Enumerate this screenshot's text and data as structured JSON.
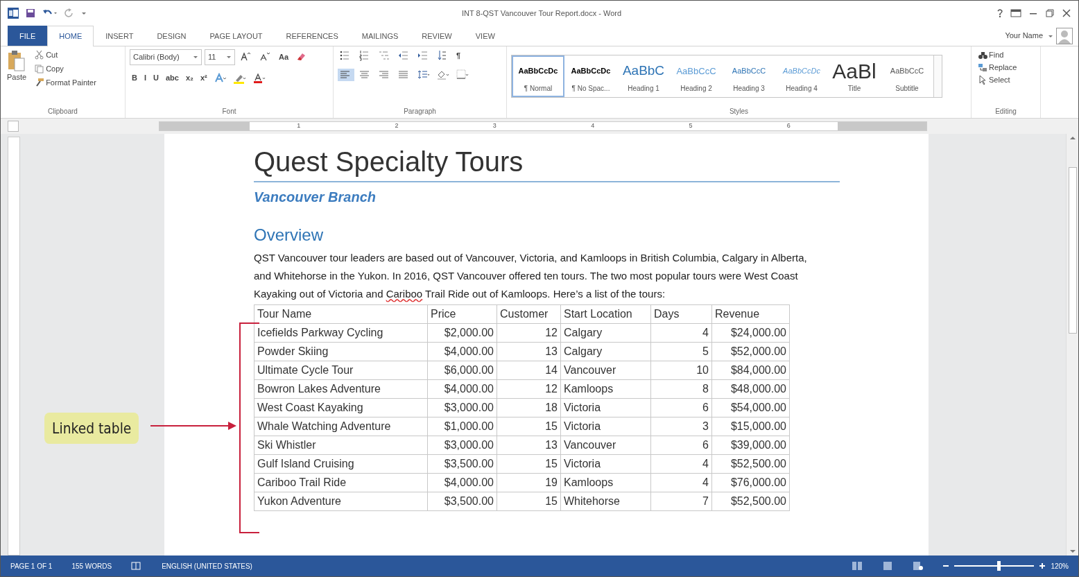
{
  "window": {
    "title": "INT 8-QST Vancouver Tour Report.docx - Word"
  },
  "tabs": [
    {
      "label": "FILE",
      "kind": "file",
      "selected": false
    },
    {
      "label": "HOME",
      "kind": "tab",
      "selected": true
    },
    {
      "label": "INSERT",
      "kind": "tab",
      "selected": false
    },
    {
      "label": "DESIGN",
      "kind": "tab",
      "selected": false
    },
    {
      "label": "PAGE LAYOUT",
      "kind": "tab",
      "selected": false
    },
    {
      "label": "REFERENCES",
      "kind": "tab",
      "selected": false
    },
    {
      "label": "MAILINGS",
      "kind": "tab",
      "selected": false
    },
    {
      "label": "REVIEW",
      "kind": "tab",
      "selected": false
    },
    {
      "label": "VIEW",
      "kind": "tab",
      "selected": false
    }
  ],
  "account": {
    "name": "Your Name"
  },
  "clipboard": {
    "label": "Clipboard",
    "paste": "Paste",
    "cut": "Cut",
    "copy": "Copy",
    "format_painter": "Format Painter"
  },
  "font": {
    "label": "Font",
    "font_name": "Calibri (Body)",
    "font_size": "11",
    "row1": [
      {
        "kind": "grow"
      },
      {
        "kind": "shrink"
      },
      {
        "kind": "case",
        "text": "Aa"
      },
      {
        "kind": "clear"
      }
    ],
    "row2": [
      {
        "kind": "text",
        "text": "B",
        "selected": false
      },
      {
        "kind": "text",
        "text": "I",
        "selected": false
      },
      {
        "kind": "text",
        "text": "U",
        "selected": false
      },
      {
        "kind": "text",
        "text": "abc",
        "selected": false
      },
      {
        "kind": "text",
        "text": "x₂",
        "selected": false
      },
      {
        "kind": "text",
        "text": "x²",
        "selected": false
      },
      {
        "kind": "effects"
      },
      {
        "kind": "highlight"
      },
      {
        "kind": "fontcolor"
      }
    ]
  },
  "paragraph": {
    "label": "Paragraph",
    "row1": [
      {
        "kind": "bullets"
      },
      {
        "kind": "numbering"
      },
      {
        "kind": "multilevel"
      },
      {
        "kind": "outdent"
      },
      {
        "kind": "indent"
      },
      {
        "kind": "sort"
      },
      {
        "kind": "text",
        "text": "¶"
      }
    ],
    "row2": [
      {
        "kind": "align-left",
        "selected": true
      },
      {
        "kind": "align-center",
        "selected": false
      },
      {
        "kind": "align-right",
        "selected": false
      },
      {
        "kind": "justify",
        "selected": false
      },
      {
        "kind": "spacing"
      },
      {
        "kind": "shading"
      },
      {
        "kind": "borders"
      }
    ]
  },
  "styles": {
    "label": "Styles",
    "items": [
      {
        "preview": "AaBbCcDc",
        "name": "¶ Normal",
        "kind": "normal",
        "selected": true
      },
      {
        "preview": "AaBbCcDc",
        "name": "¶ No Spac...",
        "kind": "normal",
        "selected": false
      },
      {
        "preview": "AaBbC",
        "name": "Heading 1",
        "kind": "heading1",
        "selected": false
      },
      {
        "preview": "AaBbCcC",
        "name": "Heading 2",
        "kind": "heading2",
        "selected": false
      },
      {
        "preview": "AaBbCcC",
        "name": "Heading 3",
        "kind": "heading3",
        "selected": false
      },
      {
        "preview": "AaBbCcDc",
        "name": "Heading 4",
        "kind": "heading4",
        "selected": false
      },
      {
        "preview": "AaBl",
        "name": "Title",
        "kind": "title",
        "selected": false
      },
      {
        "preview": "AaBbCcC",
        "name": "Subtitle",
        "kind": "subtitle",
        "selected": false
      }
    ]
  },
  "editing": {
    "label": "Editing",
    "find": "Find",
    "replace": "Replace",
    "select": "Select"
  },
  "ruler": {
    "numbers": [
      "1",
      "2",
      "3",
      "4",
      "5",
      "6"
    ]
  },
  "document": {
    "title": "Quest Specialty Tours",
    "subtitle": "Vancouver Branch",
    "heading": "Overview",
    "paragraph": [
      {
        "text": "QST Vancouver tour leaders are based out of Vancouver, Victoria, and Kamloops in British Columbia, Calgary in Alberta, and Whitehorse in the Yukon. In 2016, QST Vancouver offered ten tours. The two most popular tours were West Coast Kayaking out of Victoria and ",
        "misspelled": false
      },
      {
        "text": "Cariboo",
        "misspelled": true
      },
      {
        "text": " Trail Ride out of Kamloops. Here’s a list of the tours:",
        "misspelled": false
      }
    ],
    "table": {
      "columns": [
        {
          "label": "Tour Name",
          "numeric": false
        },
        {
          "label": "Price",
          "numeric": true
        },
        {
          "label": "Customer",
          "numeric": true
        },
        {
          "label": "Start Location",
          "numeric": false
        },
        {
          "label": "Days",
          "numeric": true
        },
        {
          "label": "Revenue",
          "numeric": true
        }
      ],
      "rows": [
        [
          "Icefields Parkway Cycling",
          "$2,000.00",
          "12",
          "Calgary",
          "4",
          "$24,000.00"
        ],
        [
          "Powder Skiing",
          "$4,000.00",
          "13",
          "Calgary",
          "5",
          "$52,000.00"
        ],
        [
          "Ultimate Cycle Tour",
          "$6,000.00",
          "14",
          "Vancouver",
          "10",
          "$84,000.00"
        ],
        [
          "Bowron Lakes Adventure",
          "$4,000.00",
          "12",
          "Kamloops",
          "8",
          "$48,000.00"
        ],
        [
          "West Coast Kayaking",
          "$3,000.00",
          "18",
          "Victoria",
          "6",
          "$54,000.00"
        ],
        [
          "Whale Watching Adventure",
          "$1,000.00",
          "15",
          "Victoria",
          "3",
          "$15,000.00"
        ],
        [
          "Ski Whistler",
          "$3,000.00",
          "13",
          "Vancouver",
          "6",
          "$39,000.00"
        ],
        [
          "Gulf Island Cruising",
          "$3,500.00",
          "15",
          "Victoria",
          "4",
          "$52,500.00"
        ],
        [
          "Cariboo Trail Ride",
          "$4,000.00",
          "19",
          "Kamloops",
          "4",
          "$76,000.00"
        ],
        [
          "Yukon Adventure",
          "$3,500.00",
          "15",
          "Whitehorse",
          "7",
          "$52,500.00"
        ]
      ]
    }
  },
  "callout": {
    "label": "Linked table"
  },
  "status_bar": {
    "page": "PAGE 1 OF 1",
    "words": "155 WORDS",
    "language": "ENGLISH (UNITED STATES)",
    "zoom": {
      "level": 0.55,
      "reading": "120%"
    }
  }
}
